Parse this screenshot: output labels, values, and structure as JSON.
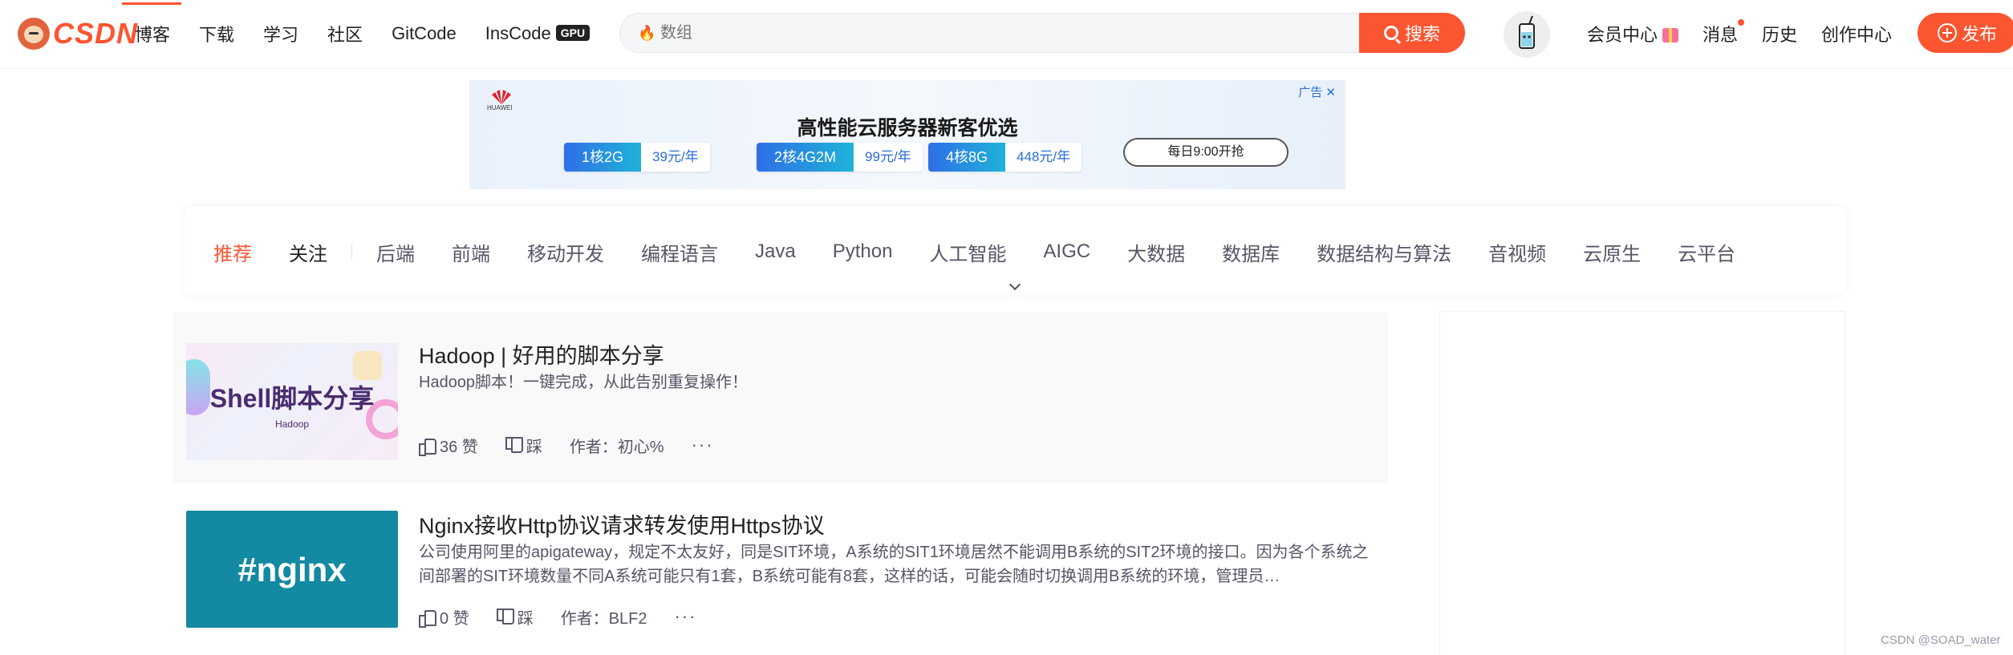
{
  "nav": {
    "logo_text": "CSDN",
    "links": [
      "博客",
      "下载",
      "学习",
      "社区",
      "GitCode",
      "InsCode"
    ],
    "gpu_badge": "GPU",
    "search_placeholder": "数组",
    "search_button": "搜索",
    "right_links": [
      "会员中心",
      "消息",
      "历史",
      "创作中心"
    ],
    "publish_button": "发布",
    "accent_color": "#fc5531"
  },
  "banner": {
    "ad_label": "广告",
    "brand": "HUAWEI",
    "headline": "高性能云服务器新客优选",
    "offers": [
      {
        "spec": "1核2G",
        "price": "39元/年"
      },
      {
        "spec": "2核4G2M",
        "price": "99元/年"
      },
      {
        "spec": "4核8G",
        "price": "448元/年"
      }
    ],
    "cta": "每日9:00开抢"
  },
  "categories": {
    "items": [
      "推荐",
      "关注",
      "后端",
      "前端",
      "移动开发",
      "编程语言",
      "Java",
      "Python",
      "人工智能",
      "AIGC",
      "大数据",
      "数据库",
      "数据结构与算法",
      "音视频",
      "云原生",
      "云平台"
    ],
    "active": "推荐"
  },
  "feed": [
    {
      "thumb_title": "Shell脚本分享",
      "thumb_sub": "Hadoop",
      "title": "Hadoop | 好用的脚本分享",
      "desc": "Hadoop脚本！一键完成，从此告别重复操作！",
      "likes": "36 赞",
      "dislike": "踩",
      "author": "作者：初心%",
      "more": "···"
    },
    {
      "thumb_title": "#nginx",
      "title": "Nginx接收Http协议请求转发使用Https协议",
      "desc": "公司使用阿里的apigateway，规定不太友好，同是SIT环境，A系统的SIT1环境居然不能调用B系统的SIT2环境的接口。因为各个系统之间部署的SIT环境数量不同A系统可能只有1套，B系统可能有8套，这样的话，可能会随时切换调用B系统的环境，管理员…",
      "likes": "0 赞",
      "dislike": "踩",
      "author": "作者：BLF2",
      "more": "···"
    }
  ],
  "watermark": "CSDN @SOAD_water"
}
